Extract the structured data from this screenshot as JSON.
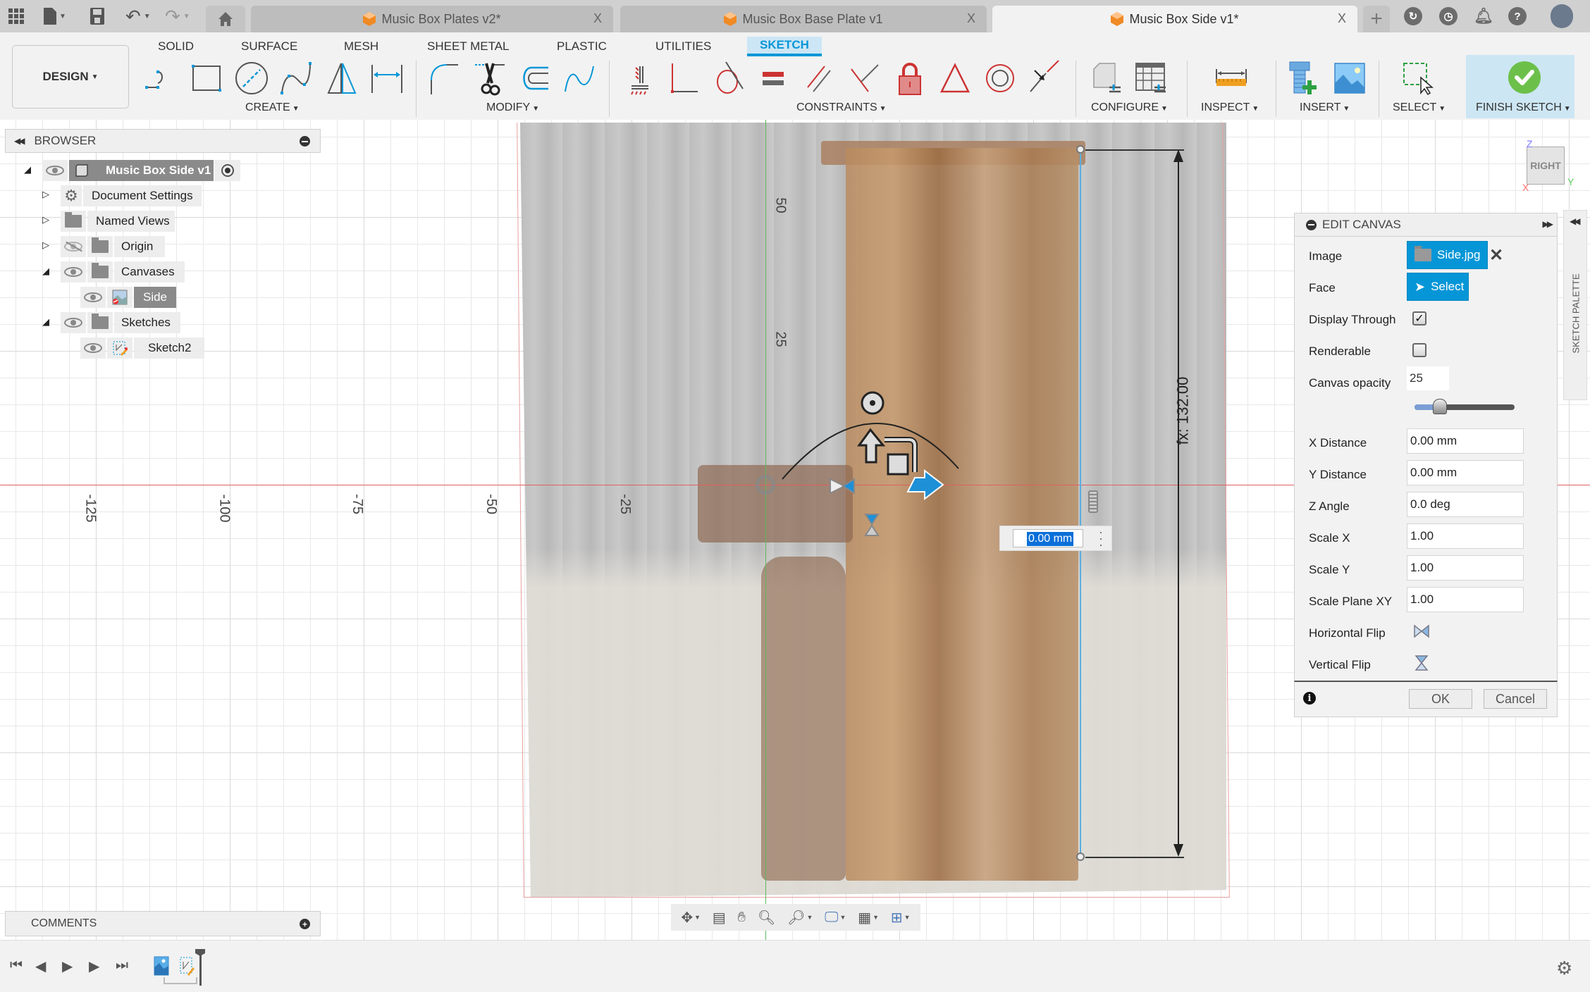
{
  "tabs": [
    {
      "label": "Music Box Plates v2*",
      "active": false
    },
    {
      "label": "Music Box Base Plate v1",
      "active": false
    },
    {
      "label": "Music Box Side v1*",
      "active": true
    }
  ],
  "toolbar": {
    "workspace_button": "DESIGN",
    "workspace_tabs": [
      "SOLID",
      "SURFACE",
      "MESH",
      "SHEET METAL",
      "PLASTIC",
      "UTILITIES",
      "SKETCH"
    ],
    "active_workspace_tab": "SKETCH",
    "groups": {
      "create": "CREATE",
      "modify": "MODIFY",
      "constraints": "CONSTRAINTS",
      "configure": "CONFIGURE",
      "inspect": "INSPECT",
      "insert": "INSERT",
      "select": "SELECT",
      "finish": "FINISH SKETCH"
    },
    "create_tools": [
      "line-icon",
      "rectangle-icon",
      "circle-icon",
      "spline-icon",
      "mirror-icon",
      "dimension-icon"
    ],
    "modify_tools": [
      "fillet-icon",
      "trim-icon",
      "offset-icon",
      "conic-curve-icon"
    ],
    "constraint_tools": [
      "fix-icon",
      "coincident-icon",
      "tangent-icon",
      "equal-icon",
      "parallel-icon",
      "perpendicular-icon",
      "lock-icon",
      "triangle-icon",
      "concentric-icon",
      "midpoint-icon"
    ],
    "accent_color": "#0696d7",
    "finish_color": "#6cc04a"
  },
  "browser": {
    "title": "BROWSER",
    "items": [
      {
        "label": "Music Box Side v1",
        "level": 0,
        "expanded": true,
        "icon": "component-icon",
        "selected": true
      },
      {
        "label": "Document Settings",
        "level": 1,
        "expanded": false,
        "icon": "gear-icon"
      },
      {
        "label": "Named Views",
        "level": 1,
        "expanded": false,
        "icon": "folder-icon"
      },
      {
        "label": "Origin",
        "level": 1,
        "expanded": false,
        "icon": "folder-icon",
        "hidden": true
      },
      {
        "label": "Canvases",
        "level": 1,
        "expanded": true,
        "icon": "folder-icon"
      },
      {
        "label": "Side",
        "level": 2,
        "icon": "canvas-image-icon",
        "selected": true
      },
      {
        "label": "Sketches",
        "level": 1,
        "expanded": true,
        "icon": "folder-icon"
      },
      {
        "label": "Sketch2",
        "level": 2,
        "icon": "sketch-icon"
      }
    ]
  },
  "viewport": {
    "x_axis_labels": [
      "-125",
      "-100",
      "-75",
      "-50",
      "-25"
    ],
    "y_axis_labels": [
      "50",
      "25"
    ],
    "dimension_text": "fx: 132.00",
    "value_input": "0.00 mm",
    "viewcube_face": "RIGHT",
    "viewcube_axes": {
      "z": "Z",
      "x": "X",
      "y": "Y"
    }
  },
  "edit_canvas": {
    "title": "EDIT CANVAS",
    "image_label": "Image",
    "image_value": "Side.jpg",
    "face_label": "Face",
    "face_value": "Select",
    "display_through_label": "Display Through",
    "display_through": true,
    "renderable_label": "Renderable",
    "renderable": false,
    "opacity_label": "Canvas opacity",
    "opacity_value": "25",
    "opacity_percent": 25,
    "fields": [
      {
        "label": "X Distance",
        "value": "0.00 mm"
      },
      {
        "label": "Y Distance",
        "value": "0.00 mm"
      },
      {
        "label": "Z Angle",
        "value": "0.0 deg"
      },
      {
        "label": "Scale X",
        "value": "1.00"
      },
      {
        "label": "Scale Y",
        "value": "1.00"
      },
      {
        "label": "Scale Plane XY",
        "value": "1.00"
      }
    ],
    "horizontal_flip_label": "Horizontal Flip",
    "vertical_flip_label": "Vertical Flip",
    "ok_label": "OK",
    "cancel_label": "Cancel"
  },
  "sketch_palette": {
    "label": "SKETCH PALETTE"
  },
  "comments": {
    "label": "COMMENTS"
  }
}
